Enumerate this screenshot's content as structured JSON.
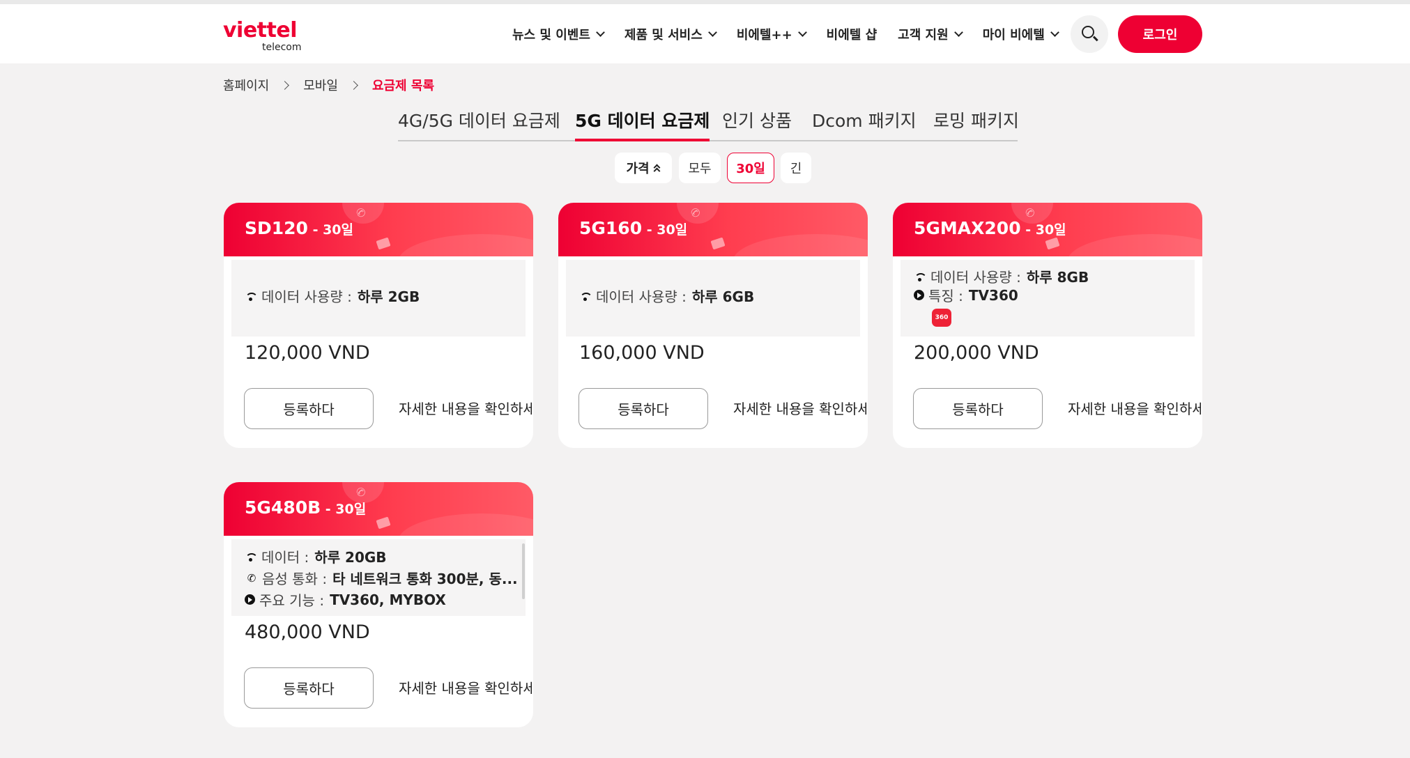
{
  "header": {
    "logo_main": "viettel",
    "logo_sub": "telecom",
    "nav": [
      {
        "label": "뉴스 및 이벤트",
        "dropdown": true
      },
      {
        "label": "제품 및 서비스",
        "dropdown": true
      },
      {
        "label": "비에텔++",
        "dropdown": true
      },
      {
        "label": "비에텔 샵",
        "dropdown": false
      },
      {
        "label": "고객 지원",
        "dropdown": true
      },
      {
        "label": "마이 비에텔",
        "dropdown": true
      }
    ],
    "search_icon": "search-icon",
    "login_label": "로그인"
  },
  "breadcrumb": {
    "items": [
      "홈페이지",
      "모바일"
    ],
    "current": "요금제 목록"
  },
  "tabs": [
    {
      "label": "4G/5G 데이터 요금제",
      "active": false
    },
    {
      "label": "5G 데이터 요금제",
      "active": true
    },
    {
      "label": "인기 상품",
      "active": false
    },
    {
      "label": "Dcom 패키지",
      "active": false
    },
    {
      "label": "로밍 패키지",
      "active": false
    }
  ],
  "filters": {
    "sort_label": "가격",
    "options": [
      {
        "label": "모두",
        "active": false
      },
      {
        "label": "30일",
        "active": true
      },
      {
        "label": "긴",
        "active": false
      }
    ]
  },
  "cards": [
    {
      "code": "SD120",
      "period": " - 30일",
      "features": [
        {
          "icon": "wifi-icon",
          "label": "데이터 사용량 :",
          "value": "하루 2GB"
        }
      ],
      "price": "120,000 VND",
      "register": "등록하다",
      "detail": "자세한 내용을 확인하세요"
    },
    {
      "code": "5G160",
      "period": " - 30일",
      "features": [
        {
          "icon": "wifi-icon",
          "label": "데이터 사용량 :",
          "value": "하루 6GB"
        }
      ],
      "price": "160,000 VND",
      "register": "등록하다",
      "detail": "자세한 내용을 확인하세요"
    },
    {
      "code": "5GMAX200",
      "period": " - 30일",
      "features": [
        {
          "icon": "wifi-icon",
          "label": "데이터 사용량 :",
          "value": "하루 8GB"
        },
        {
          "icon": "play-icon",
          "label": "특징 :",
          "value": "TV360"
        }
      ],
      "badge": "360",
      "price": "200,000 VND",
      "register": "등록하다",
      "detail": "자세한 내용을 확인하세요"
    },
    {
      "code": "5G480B",
      "period": " - 30일",
      "features": [
        {
          "icon": "wifi-icon",
          "label": "데이터 :",
          "value": "하루 20GB"
        },
        {
          "icon": "phone-icon",
          "label": "음성 통화 :",
          "value": "타 네트워크 통화 300분, 동..."
        },
        {
          "icon": "play-icon",
          "label": "주요 기능 :",
          "value": "TV360, MYBOX"
        }
      ],
      "price": "480,000 VND",
      "register": "등록하다",
      "detail": "자세한 내용을 확인하세요"
    }
  ],
  "colors": {
    "brand": "#ee0033",
    "background": "#f3f2f2"
  }
}
